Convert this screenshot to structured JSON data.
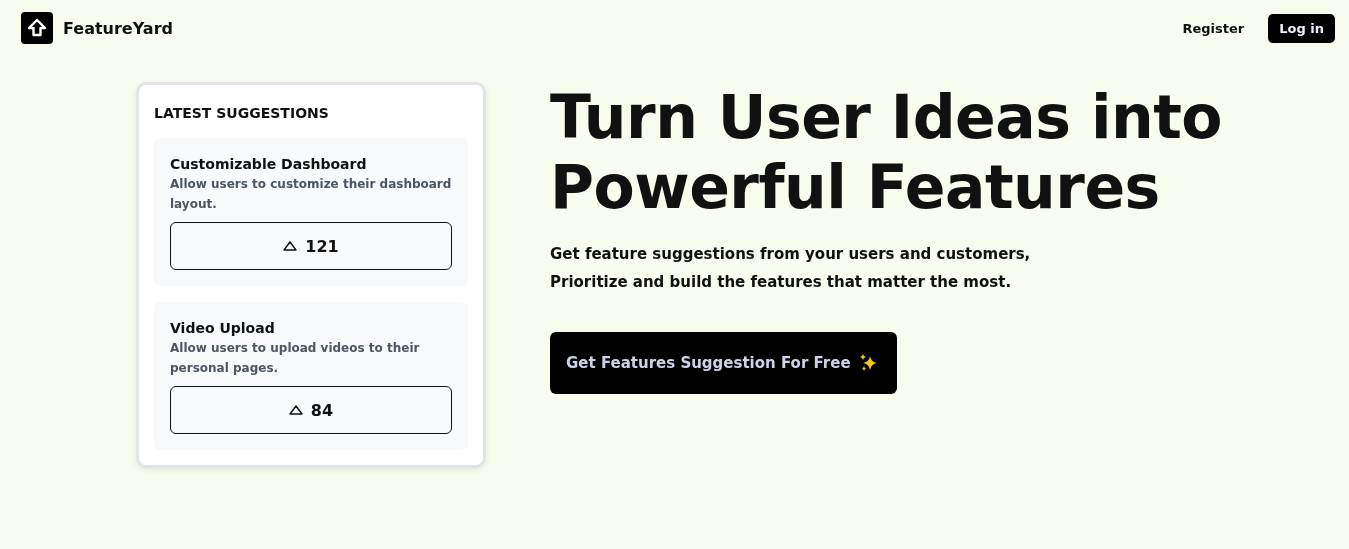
{
  "header": {
    "brand": "FeatureYard",
    "links": [
      {
        "label": "Register",
        "kind": "link"
      },
      {
        "label": "Log in",
        "kind": "button"
      }
    ]
  },
  "suggestions": {
    "title": "LATEST SUGGESTIONS",
    "items": [
      {
        "title": "Customizable Dashboard",
        "description": "Allow users to customize their dashboard layout.",
        "votes": "121"
      },
      {
        "title": "Video Upload",
        "description": "Allow users to upload videos to their personal pages.",
        "votes": "84"
      }
    ]
  },
  "hero": {
    "headline": [
      "Turn User Ideas into",
      "Powerful Features"
    ],
    "subtitle": [
      "Get feature suggestions from your users and customers,",
      "Prioritize and build the features that matter the most."
    ],
    "cta": "Get Features Suggestion For Free"
  }
}
